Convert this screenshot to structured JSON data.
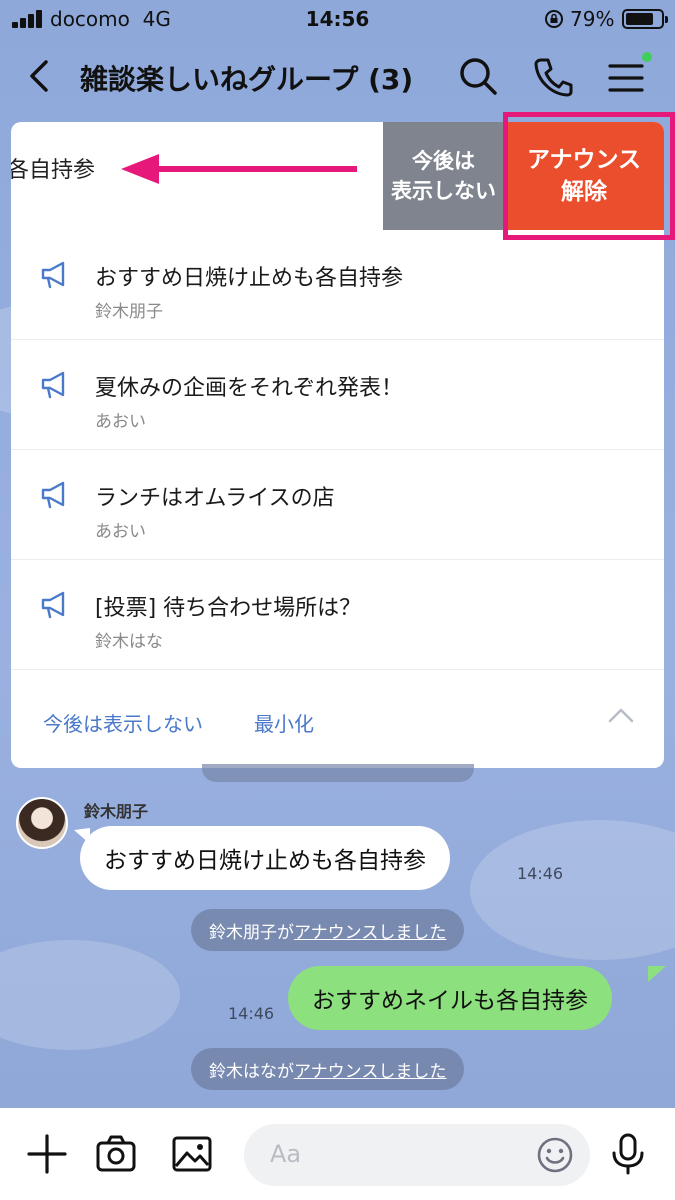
{
  "status_bar": {
    "carrier": "docomo",
    "network": "4G",
    "time": "14:56",
    "battery_percent": "79%",
    "battery_level": 0.79
  },
  "header": {
    "title": "雑談楽しいねグループ (3)",
    "icons": [
      "back-icon",
      "search-icon",
      "phone-icon",
      "menu-icon"
    ]
  },
  "announcements": {
    "swiped_text": "各自持参",
    "hide_button": [
      "今後は",
      "表示しない"
    ],
    "remove_button": [
      "アナウンス",
      "解除"
    ],
    "items": [
      {
        "text": "おすすめ日焼け止めも各自持参",
        "author": "鈴木朋子"
      },
      {
        "text": "夏休みの企画をそれぞれ発表！",
        "author": "あおい"
      },
      {
        "text": "ランチはオムライスの店",
        "author": "あおい"
      },
      {
        "text": "[投票] 待ち合わせ場所は？",
        "author": "鈴木はな"
      }
    ],
    "footer": {
      "hide_link": "今後は表示しない",
      "minimize_link": "最小化"
    }
  },
  "chat": {
    "incoming": {
      "sender": "鈴木朋子",
      "text": "おすすめ日焼け止めも各自持参",
      "time": "14:46"
    },
    "system1": {
      "name": "鈴木朋子が",
      "link": "アナウンスしました"
    },
    "outgoing": {
      "text": "おすすめネイルも各自持参",
      "time": "14:46"
    },
    "system2": {
      "name": "鈴木はなが",
      "link": "アナウンスしました"
    }
  },
  "input": {
    "placeholder": "Aa"
  },
  "colors": {
    "accent_link": "#4a79c9",
    "remove_button": "#ea4e2c",
    "hide_button": "#80848f",
    "highlight": "#e6197a",
    "outgoing_bubble": "#8de07e"
  }
}
